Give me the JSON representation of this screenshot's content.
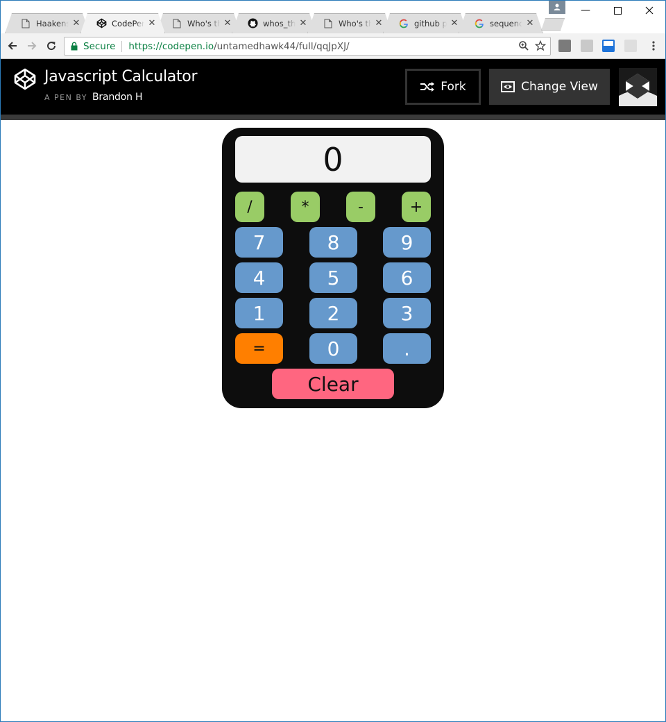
{
  "browser": {
    "tabs": [
      {
        "title": "Haakenst",
        "icon": "page-icon",
        "active": false
      },
      {
        "title": "CodePen",
        "icon": "codepen-icon",
        "active": true
      },
      {
        "title": "Who's th",
        "icon": "page-icon",
        "active": false
      },
      {
        "title": "whos_tha",
        "icon": "github-icon",
        "active": false
      },
      {
        "title": "Who's th",
        "icon": "page-icon",
        "active": false
      },
      {
        "title": "github pa",
        "icon": "google-icon",
        "active": false
      },
      {
        "title": "sequence",
        "icon": "google-icon",
        "active": false
      }
    ],
    "close_glyph": "✕",
    "secure_label": "Secure",
    "url_scheme": "https://",
    "url_host": "codepen.io",
    "url_path": "/untamedhawk44/full/qqJpXJ/"
  },
  "codepen": {
    "title": "Javascript Calculator",
    "byline": "A PEN BY",
    "author": "Brandon H",
    "fork_label": "Fork",
    "change_view_label": "Change View"
  },
  "calculator": {
    "display": "0",
    "operators": [
      "/",
      "*",
      "-",
      "+"
    ],
    "rows": [
      [
        "7",
        "8",
        "9"
      ],
      [
        "4",
        "5",
        "6"
      ],
      [
        "1",
        "2",
        "3"
      ],
      [
        "=",
        "0",
        "."
      ]
    ],
    "clear_label": "Clear",
    "colors": {
      "body": "#0d0d0d",
      "display": "#f2f2f2",
      "operator": "#99cc66",
      "number": "#6699cc",
      "equals": "#ff7f00",
      "clear": "#ff6680"
    }
  }
}
